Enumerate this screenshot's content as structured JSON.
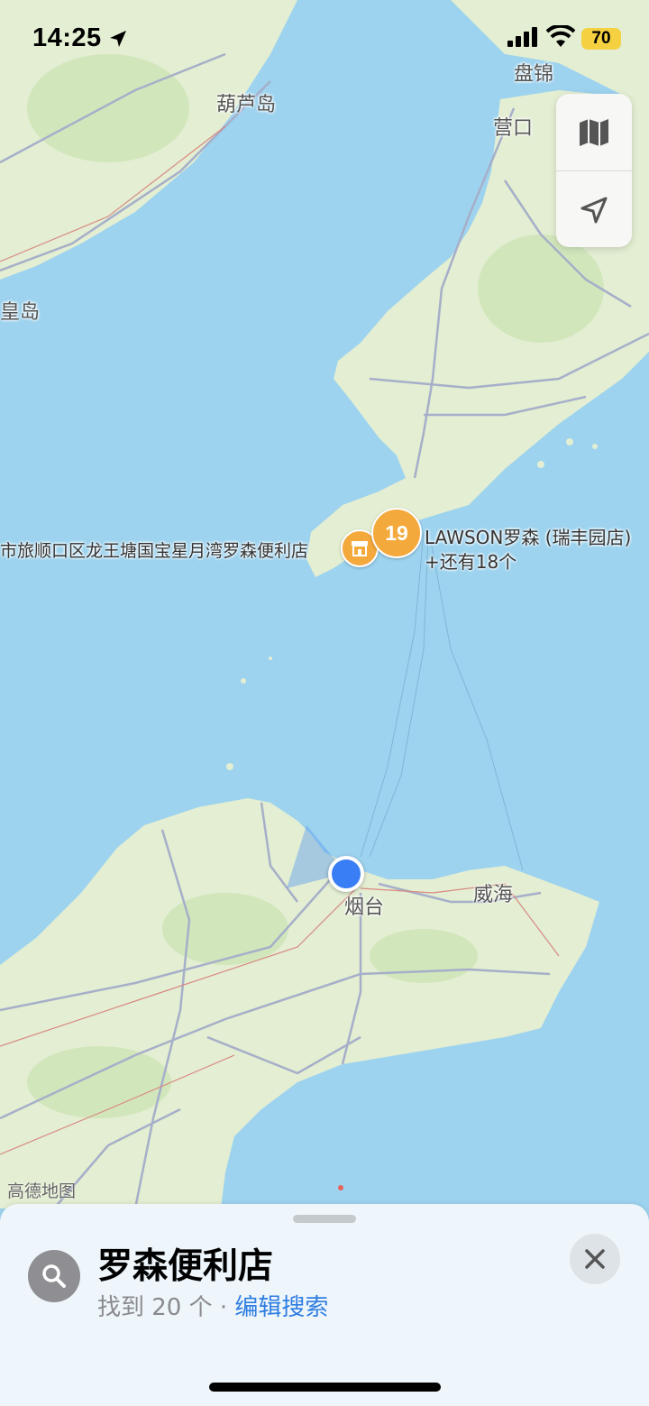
{
  "status_bar": {
    "time": "14:25",
    "battery": "70"
  },
  "map": {
    "labels": {
      "huludao": "葫芦岛",
      "panjin": "盘锦",
      "yingkou": "营口",
      "qinhuangdao_partial": "皇岛",
      "yantai": "烟台",
      "weihai": "威海"
    },
    "poi": {
      "left_store_label": "市旅顺口区龙王塘国宝星月湾罗森便利店",
      "cluster_count": "19",
      "cluster_title": "LAWSON罗森 (瑞丰园店)",
      "cluster_more": "+还有18个"
    },
    "watermark": "高德地图",
    "colors": {
      "water": "#9dd3ef",
      "land": "#e4efd2",
      "poi": "#f4a93c",
      "user_location": "#3a7ef6"
    }
  },
  "controls": {
    "map_mode_icon": "map-icon",
    "locate_icon": "location-arrow-icon"
  },
  "sheet": {
    "title": "罗森便利店",
    "result_count": "找到 20 个",
    "separator": "·",
    "edit_link": "编辑搜索"
  }
}
